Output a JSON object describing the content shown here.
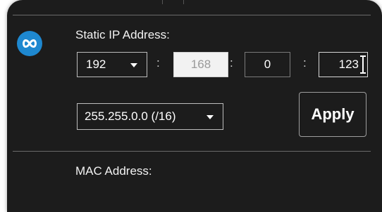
{
  "static_ip": {
    "label": "Static IP Address:",
    "octet1": "192",
    "octet2": "168",
    "octet3": "0",
    "octet4": "123",
    "separator": ":"
  },
  "subnet": {
    "value": "255.255.0.0 (/16)"
  },
  "apply_label": "Apply",
  "mac": {
    "label": "MAC Address:"
  },
  "icons": {
    "app": "infinity-icon",
    "dropdown": "chevron-down-icon"
  },
  "colors": {
    "accent": "#1e88d0",
    "panel": "#1c1c1c"
  }
}
